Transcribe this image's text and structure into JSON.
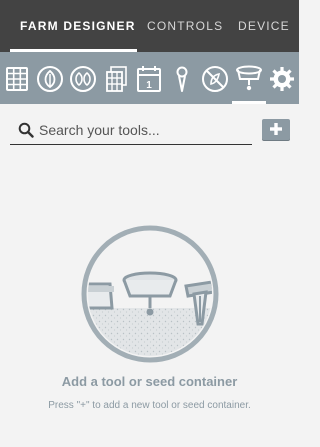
{
  "nav": {
    "tabs": [
      {
        "label": "FARM DESIGNER",
        "active": true
      },
      {
        "label": "CONTROLS",
        "active": false
      },
      {
        "label": "DEVICE",
        "active": false
      }
    ]
  },
  "panels": [
    {
      "icon": "map-grid-icon"
    },
    {
      "icon": "plant-leaf-icon"
    },
    {
      "icon": "plant-groups-icon"
    },
    {
      "icon": "saved-gardens-icon"
    },
    {
      "icon": "calendar-icon",
      "text": "1"
    },
    {
      "icon": "point-pin-icon"
    },
    {
      "icon": "weed-icon"
    },
    {
      "icon": "tool-mount-icon",
      "active": true
    },
    {
      "icon": "gear-icon"
    }
  ],
  "search": {
    "placeholder": "Search your tools..."
  },
  "add_button": {
    "symbol": "+"
  },
  "empty_state": {
    "title": "Add a tool or seed container",
    "description": "Press \"+\" to add a new tool or seed container."
  },
  "colors": {
    "nav_bg": "#434343",
    "panel_bar_bg": "#8c9aa3",
    "page_bg": "#f3f3f3",
    "muted_text": "#8c9aa3"
  }
}
